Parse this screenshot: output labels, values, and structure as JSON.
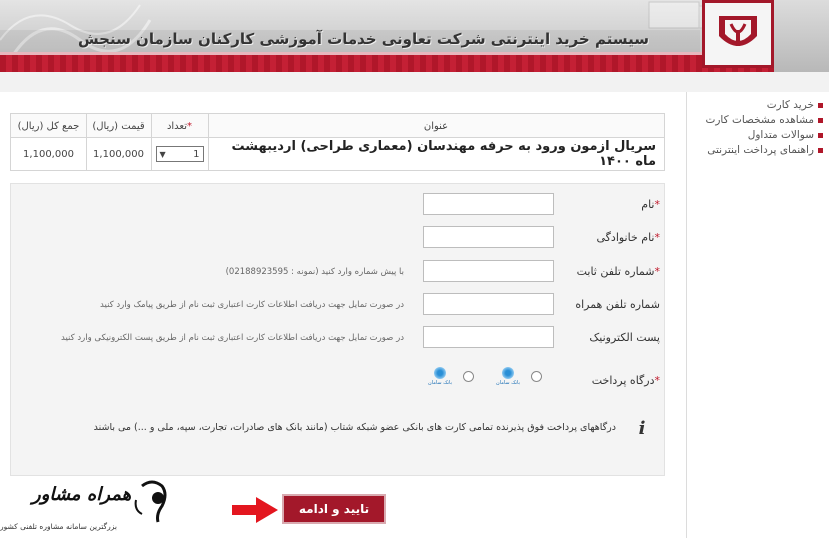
{
  "header": {
    "title": "سیستم خرید اینترنتی شرکت تعاونی خدمات آموزشی کارکنان سازمان سنجش"
  },
  "sidebar": {
    "items": [
      {
        "label": "خرید کارت"
      },
      {
        "label": "مشاهده مشخصات کارت"
      },
      {
        "label": "سوالات متداول"
      },
      {
        "label": "راهنمای پرداخت اینترنتی"
      }
    ]
  },
  "product_table": {
    "headers": {
      "title": "عنوان",
      "quantity": "تعداد",
      "quantity_star": "*",
      "price": "قیمت (ریال)",
      "total": "جمع کل (ریال)"
    },
    "row": {
      "title": "سریال ازمون ورود به حرفه مهندسان (معماری طراحی) اردیبهشت ماه ۱۴۰۰",
      "quantity": "1",
      "price": "1,100,000",
      "total": "1,100,000"
    }
  },
  "form": {
    "fields": [
      {
        "label": "نام",
        "required": true,
        "value": "",
        "hint": ""
      },
      {
        "label": "نام خانوادگی",
        "required": true,
        "value": "",
        "hint": ""
      },
      {
        "label": "شماره تلفن ثابت",
        "required": true,
        "value": "",
        "hint": "با پیش شماره وارد کنید (نمونه : 02188923595)"
      },
      {
        "label": "شماره تلفن همراه",
        "required": false,
        "value": "",
        "hint": "در صورت تمایل جهت دریافت اطلاعات کارت اعتباری ثبت نام از طریق پیامک وارد کنید"
      },
      {
        "label": "پست الکترونیک",
        "required": false,
        "value": "",
        "hint": "در صورت تمایل جهت دریافت اطلاعات کارت اعتباری ثبت نام از طریق پست الکترونیکی وارد کنید"
      }
    ],
    "gateway": {
      "label": "درگاه پرداخت",
      "required": true,
      "options": [
        {
          "bank": "بانک سامان"
        },
        {
          "bank": "بانک سامان"
        }
      ]
    },
    "info_text": "درگاههای پرداخت فوق پذیرنده تمامی کارت های بانکی عضو شبکه شتاب (مانند بانک های صادرات، تجارت، سپه، ملی و ...) می باشند",
    "star": "*"
  },
  "submit": {
    "label": "تایید و ادامه"
  },
  "watermark": {
    "name": "همراه مشاور",
    "subtitle": "بزرگترین سامانه مشاوره تلفنی کشور"
  },
  "colors": {
    "brand_red": "#a3182a",
    "accent_red": "#c0182b"
  }
}
